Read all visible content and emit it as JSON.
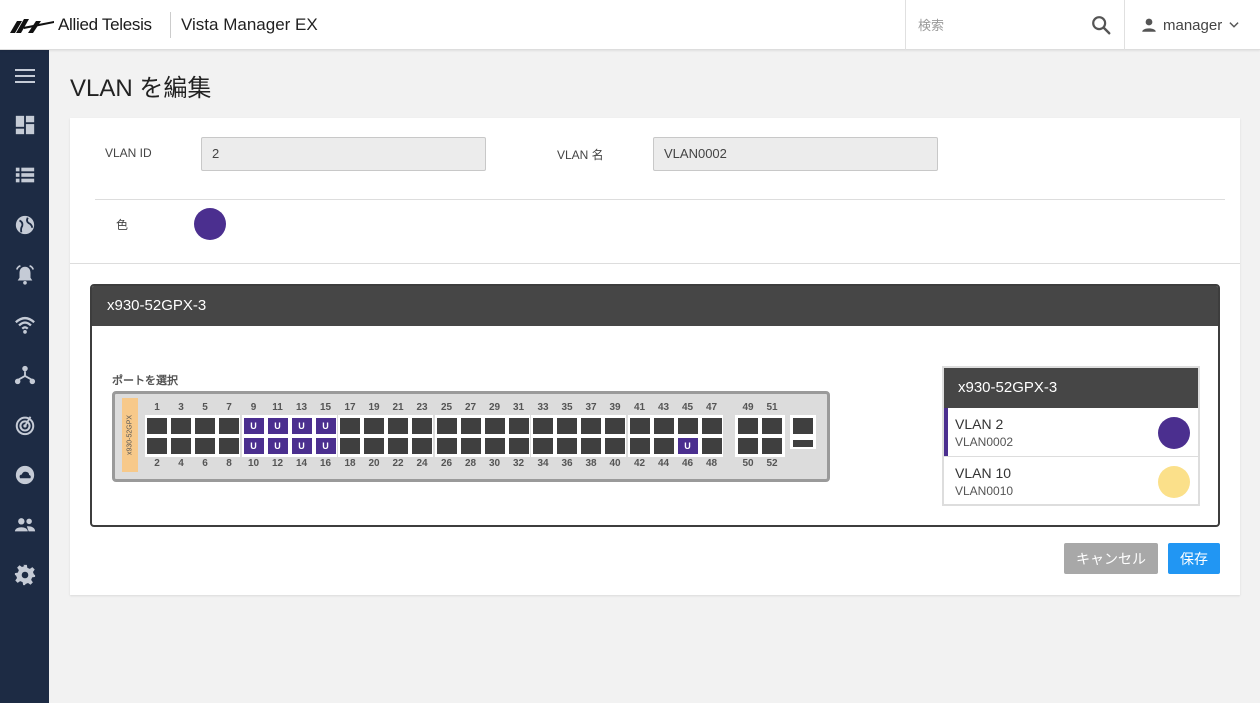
{
  "header": {
    "brand": "Allied Telesis",
    "app_title": "Vista Manager EX",
    "search_placeholder": "検索",
    "user": "manager"
  },
  "sidebar": {
    "items": [
      "menu-icon",
      "dashboard-icon",
      "list-icon",
      "globe-icon",
      "alarm-icon",
      "wifi-icon",
      "network-icon",
      "radar-icon",
      "cloud-icon",
      "users-icon",
      "settings-icon"
    ]
  },
  "page": {
    "title": "VLAN を編集"
  },
  "form": {
    "vlan_id_label": "VLAN ID",
    "vlan_id_value": "2",
    "vlan_name_label": "VLAN 名",
    "vlan_name_value": "VLAN0002",
    "color_label": "色",
    "color_value": "#4b2f8f"
  },
  "device": {
    "name": "x930-52GPX-3",
    "select_label": "ポートを選択",
    "model_tag": "x930-52GPX",
    "top_ports": [
      1,
      3,
      5,
      7,
      9,
      11,
      13,
      15,
      17,
      19,
      21,
      23,
      25,
      27,
      29,
      31,
      33,
      35,
      37,
      39,
      41,
      43,
      45,
      47
    ],
    "bottom_ports": [
      2,
      4,
      6,
      8,
      10,
      12,
      14,
      16,
      18,
      20,
      22,
      24,
      26,
      28,
      30,
      32,
      34,
      36,
      38,
      40,
      42,
      44,
      46,
      48
    ],
    "uplink_top": [
      49,
      51
    ],
    "uplink_bottom": [
      50,
      52
    ],
    "untagged_ports": [
      9,
      10,
      11,
      12,
      13,
      14,
      15,
      16,
      46
    ],
    "untagged_marker": "U"
  },
  "vlan_list": {
    "title": "x930-52GPX-3",
    "items": [
      {
        "name": "VLAN 2",
        "sub": "VLAN0002",
        "color": "#4b2f8f",
        "selected": true
      },
      {
        "name": "VLAN 10",
        "sub": "VLAN0010",
        "color": "#fbe08a",
        "selected": false
      }
    ]
  },
  "buttons": {
    "cancel": "キャンセル",
    "save": "保存"
  },
  "colors": {
    "sidebar": "#1d2b44",
    "accent": "#2196f3",
    "cancel": "#a8a8a8"
  }
}
